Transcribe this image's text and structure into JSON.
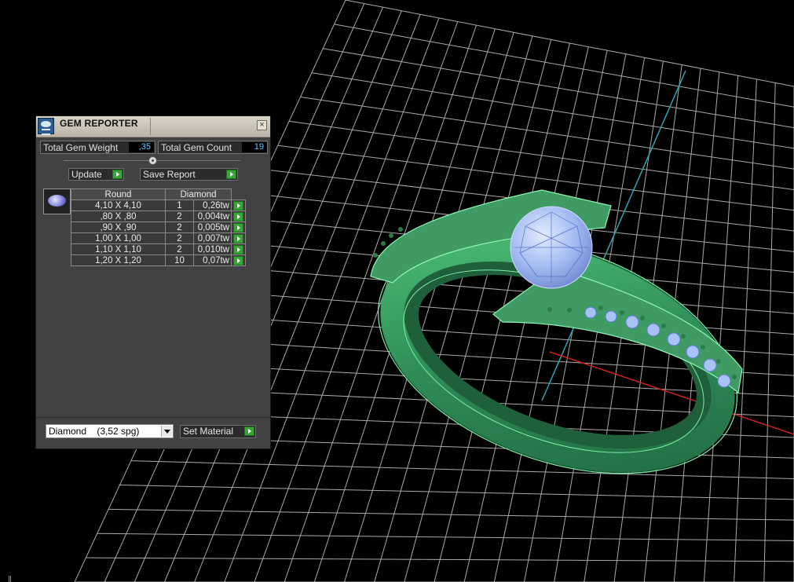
{
  "panel": {
    "title": "GEM REPORTER",
    "close_glyph": "×",
    "total_weight_label": "Total Gem Weight",
    "total_weight_value": ",35",
    "total_count_label": "Total Gem Count",
    "total_count_value": "19",
    "update_label": "Update",
    "save_report_label": "Save Report",
    "table": {
      "headers": [
        "Round",
        "Diamond"
      ],
      "rows": [
        {
          "size": "4,10 X 4,10",
          "qty": "1",
          "weight": "0,26tw"
        },
        {
          "size": ",80 X ,80",
          "qty": "2",
          "weight": "0,004tw"
        },
        {
          "size": ",90 X ,90",
          "qty": "2",
          "weight": "0,005tw"
        },
        {
          "size": "1,00 X 1,00",
          "qty": "2",
          "weight": "0,007tw"
        },
        {
          "size": "1,10 X 1,10",
          "qty": "2",
          "weight": "0,010tw"
        },
        {
          "size": "1,20 X 1,20",
          "qty": "10",
          "weight": "0,07tw"
        }
      ]
    },
    "material_select": "Diamond    (3,52 spg)",
    "set_material_label": "Set Material"
  },
  "icons": {
    "title": "gem-reporter-icon",
    "gem": "round-gem-icon",
    "go": "green-arrow-icon"
  },
  "colors": {
    "ring": "#3fa866",
    "gem": "#9fb8f0",
    "grid": "#bdbdbd",
    "panel_bg": "#424242"
  }
}
